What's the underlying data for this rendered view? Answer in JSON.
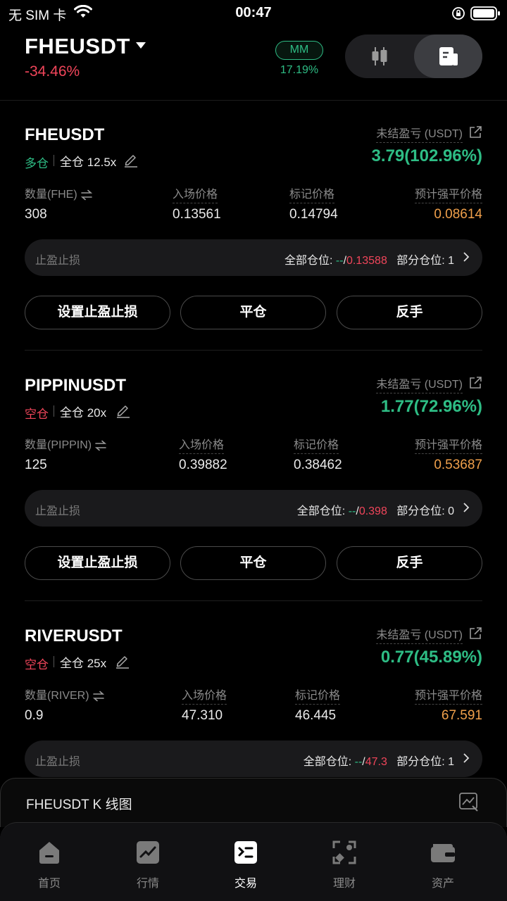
{
  "status_bar": {
    "carrier": "无 SIM 卡",
    "time": "00:47"
  },
  "header": {
    "symbol": "FHEUSDT",
    "change": "-34.46%",
    "mm_label": "MM",
    "mm_value": "17.19%"
  },
  "positions": [
    {
      "pair": "FHEUSDT",
      "side": "多仓",
      "mode": "全仓 12.5x",
      "pnl_label": "未结盈亏 (USDT)",
      "pnl_value": "3.79(102.96%)",
      "qty_label": "数量(FHE)",
      "entry_label": "入场价格",
      "mark_label": "标记价格",
      "liq_label": "预计强平价格",
      "qty": "308",
      "entry": "0.13561",
      "mark": "0.14794",
      "liq": "0.08614",
      "tpsl_label": "止盈止损",
      "all_label": "全部仓位: ",
      "all_tp": "--",
      "all_slash": "/",
      "all_sl": "0.13588",
      "partial_label": "部分仓位: 1"
    },
    {
      "pair": "PIPPINUSDT",
      "side": "空仓",
      "mode": "全仓 20x",
      "pnl_label": "未结盈亏 (USDT)",
      "pnl_value": "1.77(72.96%)",
      "qty_label": "数量(PIPPIN)",
      "entry_label": "入场价格",
      "mark_label": "标记价格",
      "liq_label": "预计强平价格",
      "qty": "125",
      "entry": "0.39882",
      "mark": "0.38462",
      "liq": "0.53687",
      "tpsl_label": "止盈止损",
      "all_label": "全部仓位: ",
      "all_tp": "--",
      "all_slash": "/",
      "all_sl": "0.398",
      "partial_label": "部分仓位: 0"
    },
    {
      "pair": "RIVERUSDT",
      "side": "空仓",
      "mode": "全仓 25x",
      "pnl_label": "未结盈亏 (USDT)",
      "pnl_value": "0.77(45.89%)",
      "qty_label": "数量(RIVER)",
      "entry_label": "入场价格",
      "mark_label": "标记价格",
      "liq_label": "预计强平价格",
      "qty": "0.9",
      "entry": "47.310",
      "mark": "46.445",
      "liq": "67.591",
      "tpsl_label": "止盈止损",
      "all_label": "全部仓位: ",
      "all_tp": "--",
      "all_slash": "/",
      "all_sl": "47.3",
      "partial_label": "部分仓位: 1"
    }
  ],
  "buttons": {
    "set_tpsl": "设置止盈止损",
    "close": "平仓",
    "reverse": "反手"
  },
  "chart_panel": {
    "title": "FHEUSDT K 线图"
  },
  "tabs": [
    {
      "label": "首页",
      "icon": "home-icon"
    },
    {
      "label": "行情",
      "icon": "market-chart-icon"
    },
    {
      "label": "交易",
      "icon": "trade-icon"
    },
    {
      "label": "理财",
      "icon": "earn-icon"
    },
    {
      "label": "资产",
      "icon": "wallet-icon"
    }
  ],
  "colors": {
    "up": "#2ebd85",
    "down": "#f0455a",
    "liq": "#f0a04b"
  }
}
